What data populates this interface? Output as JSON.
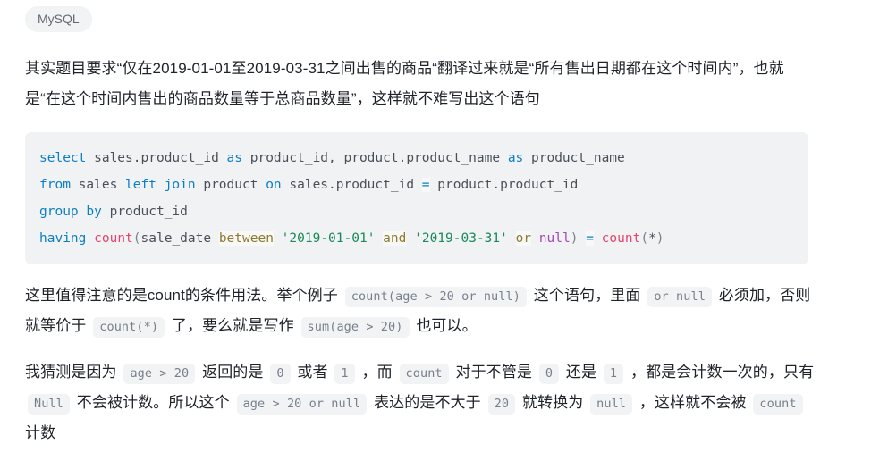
{
  "tags": [
    {
      "label": "MySQL",
      "name": "tag-mysql"
    }
  ],
  "paragraphs": {
    "p1": "其实题目要求“仅在2019-01-01至2019-03-31之间出售的商品“翻译过来就是“所有售出日期都在这个时间内”，也就是“在这个时间内售出的商品数量等于总商品数量”，这样就不难写出这个语句",
    "p2": {
      "t1": "这里值得注意的是count的条件用法。举个例子",
      "c1": "count(age > 20 or null)",
      "t2": "这个语句，里面",
      "c2": "or null",
      "t3": "必须加，否则就等价于",
      "c3": "count(*)",
      "t4": "了，要么就是写作",
      "c4": "sum(age > 20)",
      "t5": "也可以。"
    },
    "p3": {
      "t1": "我猜测是因为",
      "c1": "age > 20",
      "t2": "返回的是",
      "c2": "0",
      "t3": "或者",
      "c3": "1",
      "t4": "，而",
      "c4": "count",
      "t5": "对于不管是",
      "c5": "0",
      "t6": "还是",
      "c6": "1",
      "t7": "，都是会计数一次的，只有",
      "c7": "Null",
      "t8": "不会被计数。所以这个",
      "c8": "age > 20 or null",
      "t9": "表达的是不大于",
      "c9": "20",
      "t10": "就转换为",
      "c10": "null",
      "t11": "，这样就不会被",
      "c11": "count",
      "t12": "计数"
    }
  },
  "code_block": {
    "language": "sql",
    "lines": [
      {
        "tokens": [
          {
            "t": "select",
            "c": "k"
          },
          {
            "t": " sales.product_id ",
            "c": "id"
          },
          {
            "t": "as",
            "c": "k"
          },
          {
            "t": " product_id, product.product_name ",
            "c": "id"
          },
          {
            "t": "as",
            "c": "k"
          },
          {
            "t": " product_name",
            "c": "id"
          }
        ]
      },
      {
        "tokens": [
          {
            "t": "from",
            "c": "k"
          },
          {
            "t": " sales ",
            "c": "id"
          },
          {
            "t": "left",
            "c": "k"
          },
          {
            "t": " ",
            "c": "id"
          },
          {
            "t": "join",
            "c": "k"
          },
          {
            "t": " product ",
            "c": "id"
          },
          {
            "t": "on",
            "c": "k"
          },
          {
            "t": " sales.product_id ",
            "c": "id"
          },
          {
            "t": "=",
            "c": "op"
          },
          {
            "t": " product.product_id",
            "c": "id"
          }
        ]
      },
      {
        "tokens": [
          {
            "t": "group",
            "c": "k"
          },
          {
            "t": " ",
            "c": "id"
          },
          {
            "t": "by",
            "c": "k"
          },
          {
            "t": " product_id",
            "c": "id"
          }
        ]
      },
      {
        "tokens": [
          {
            "t": "having",
            "c": "k"
          },
          {
            "t": " ",
            "c": "id"
          },
          {
            "t": "count",
            "c": "fn"
          },
          {
            "t": "(",
            "c": "pn"
          },
          {
            "t": "sale_date ",
            "c": "id"
          },
          {
            "t": "between",
            "c": "kw2"
          },
          {
            "t": " ",
            "c": "id"
          },
          {
            "t": "'2019-01-01'",
            "c": "str"
          },
          {
            "t": " ",
            "c": "id"
          },
          {
            "t": "and",
            "c": "kw2"
          },
          {
            "t": " ",
            "c": "id"
          },
          {
            "t": "'2019-03-31'",
            "c": "str"
          },
          {
            "t": " ",
            "c": "id"
          },
          {
            "t": "or",
            "c": "kw2"
          },
          {
            "t": " ",
            "c": "id"
          },
          {
            "t": "null",
            "c": "nul"
          },
          {
            "t": ")",
            "c": "pn"
          },
          {
            "t": " ",
            "c": "id"
          },
          {
            "t": "=",
            "c": "op"
          },
          {
            "t": " ",
            "c": "id"
          },
          {
            "t": "count",
            "c": "fn"
          },
          {
            "t": "(",
            "c": "pn"
          },
          {
            "t": "*",
            "c": "id"
          },
          {
            "t": ")",
            "c": "pn"
          }
        ]
      }
    ]
  },
  "colors": {
    "page_bg": "#ffffff",
    "text": "#1f2329",
    "tag_bg": "#f2f3f5",
    "tag_text": "#646a73",
    "code_bg": "#f1f2f4",
    "inline_code_bg": "#f2f3f5",
    "inline_code_text": "#77808b",
    "keyword": "#0b7fc4",
    "function": "#e2466e",
    "string": "#1a8a5a",
    "null": "#a349b5",
    "operator_kw": "#8f7a33"
  }
}
